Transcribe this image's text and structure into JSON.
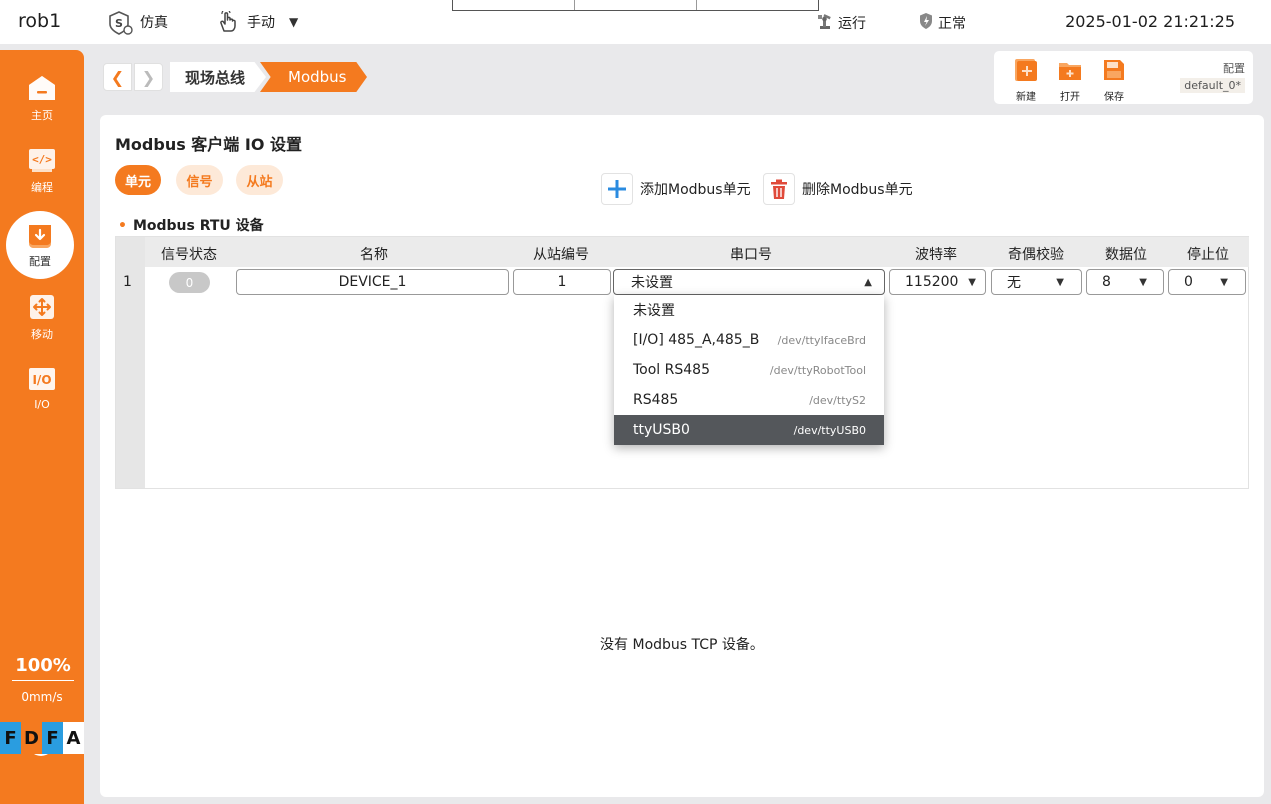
{
  "topbar": {
    "robot_name": "rob1",
    "mode_sim": "仿真",
    "mode_manual": "手动",
    "status_run": "运行",
    "status_ok": "正常",
    "datetime": "2025-01-02 21:21:25"
  },
  "sidebar": {
    "items": [
      {
        "label": "主页",
        "icon": "home-icon"
      },
      {
        "label": "编程",
        "icon": "code-icon"
      },
      {
        "label": "配置",
        "icon": "config-icon"
      },
      {
        "label": "移动",
        "icon": "move-icon"
      },
      {
        "label": "I/O",
        "icon": "io-icon"
      }
    ],
    "speed_percent": "100%",
    "speed_value": "0mm/s",
    "brand": [
      "F",
      "D",
      "F",
      "A"
    ]
  },
  "breadcrumb": {
    "items": [
      "现场总线",
      "Modbus"
    ]
  },
  "config": {
    "new_label": "新建",
    "open_label": "打开",
    "save_label": "保存",
    "title": "配置",
    "current": "default_0*"
  },
  "panel": {
    "title": "Modbus 客户端 IO 设置",
    "tabs": [
      "单元",
      "信号",
      "从站"
    ],
    "add_label": "添加Modbus单元",
    "delete_label": "删除Modbus单元",
    "section_title": "Modbus RTU 设备",
    "table": {
      "columns": [
        "信号状态",
        "名称",
        "从站编号",
        "串口号",
        "波特率",
        "奇偶校验",
        "数据位",
        "停止位"
      ],
      "rows": [
        {
          "index": "1",
          "signal": "0",
          "name": "DEVICE_1",
          "slave_id": "1",
          "serial_port": "未设置",
          "baud": "115200",
          "parity": "无",
          "data_bits": "8",
          "stop_bits": "0"
        }
      ]
    },
    "serial_dropdown": [
      {
        "label": "未设置",
        "device": ""
      },
      {
        "label": "[I/O] 485_A,485_B",
        "device": "/dev/ttyIfaceBrd"
      },
      {
        "label": "Tool RS485",
        "device": "/dev/ttyRobotTool"
      },
      {
        "label": "RS485",
        "device": "/dev/ttyS2"
      },
      {
        "label": "ttyUSB0",
        "device": "/dev/ttyUSB0",
        "highlighted": true
      }
    ],
    "tcp_empty": "没有 Modbus TCP 设备。"
  },
  "colors": {
    "accent": "#f47a1f",
    "accent_light": "#fde9d8",
    "add_blue": "#2a8be0",
    "delete_red": "#e04a3a",
    "dropdown_selected": "#54575b"
  }
}
